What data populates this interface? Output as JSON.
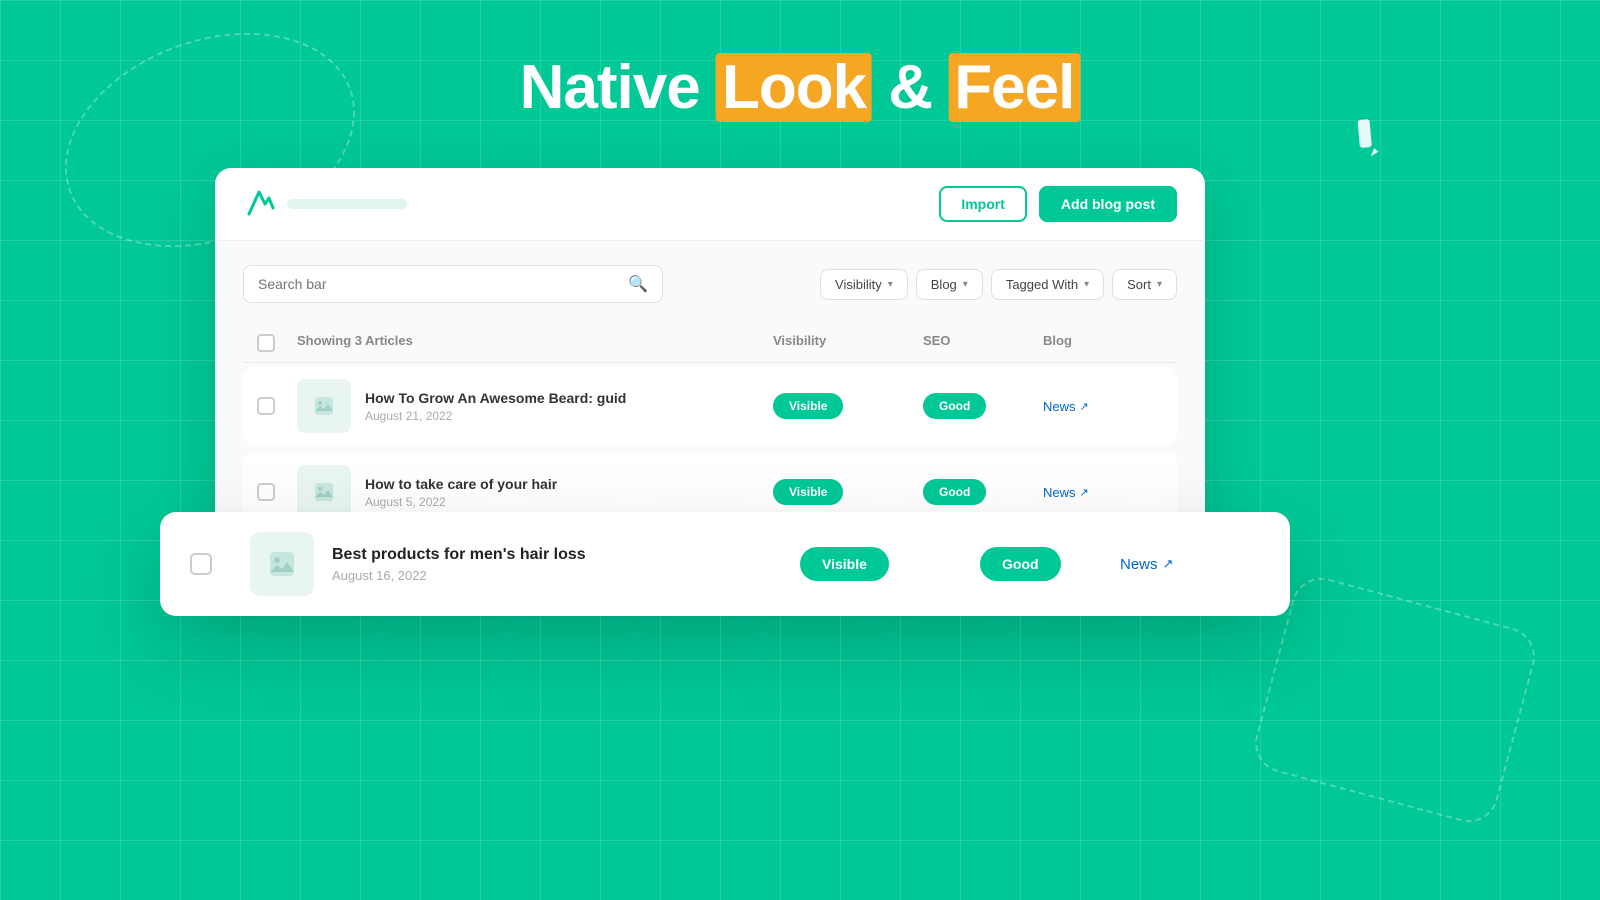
{
  "page": {
    "background_color": "#00c896"
  },
  "headline": {
    "part1": "Native ",
    "highlight1": "Look",
    "part2": " & ",
    "highlight2": "Feel"
  },
  "header": {
    "import_label": "Import",
    "add_post_label": "Add blog post"
  },
  "toolbar": {
    "search_placeholder": "Search bar",
    "filter_visibility": "Visibility",
    "filter_blog": "Blog",
    "filter_tagged": "Tagged With",
    "filter_sort": "Sort"
  },
  "table": {
    "showing_label": "Showing 3 Articles",
    "col_visibility": "Visibility",
    "col_seo": "SEO",
    "col_blog": "Blog"
  },
  "articles": [
    {
      "title": "How To Grow An Awesome Beard: guid",
      "date": "August 21, 2022",
      "visibility": "Visible",
      "seo": "Good",
      "blog": "News"
    },
    {
      "title": "Best products for men's hair loss",
      "date": "August 16, 2022",
      "visibility": "Visible",
      "seo": "Good",
      "blog": "News"
    },
    {
      "title": "How to take care of your hair",
      "date": "August 5, 2022",
      "visibility": "Visible",
      "seo": "Good",
      "blog": "News"
    }
  ],
  "icons": {
    "search": "🔍",
    "pen": "✏️",
    "image": "🖼",
    "external_link": "↗"
  }
}
